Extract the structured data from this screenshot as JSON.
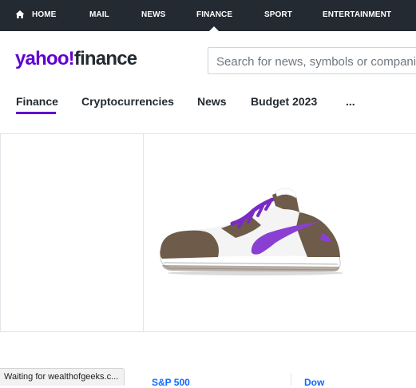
{
  "topnav": {
    "home": "HOME",
    "mail": "MAIL",
    "news": "NEWS",
    "finance": "FINANCE",
    "sport": "SPORT",
    "entertainment": "ENTERTAINMENT",
    "active": "FINANCE"
  },
  "logo": {
    "yahoo": "yahoo!",
    "finance": "finance"
  },
  "search": {
    "placeholder": "Search for news, symbols or companies"
  },
  "subnav": {
    "tabs": [
      "Finance",
      "Cryptocurrencies",
      "News",
      "Budget 2023",
      "..."
    ],
    "active": "Finance"
  },
  "ad": {
    "product": "sneaker-image"
  },
  "tickers": [
    "S&P 500",
    "Dow"
  ],
  "status": "Waiting for wealthofgeeks.c...",
  "colors": {
    "brand": "#6001d2",
    "nav_bg": "#232a31",
    "link": "#0f69ff"
  }
}
